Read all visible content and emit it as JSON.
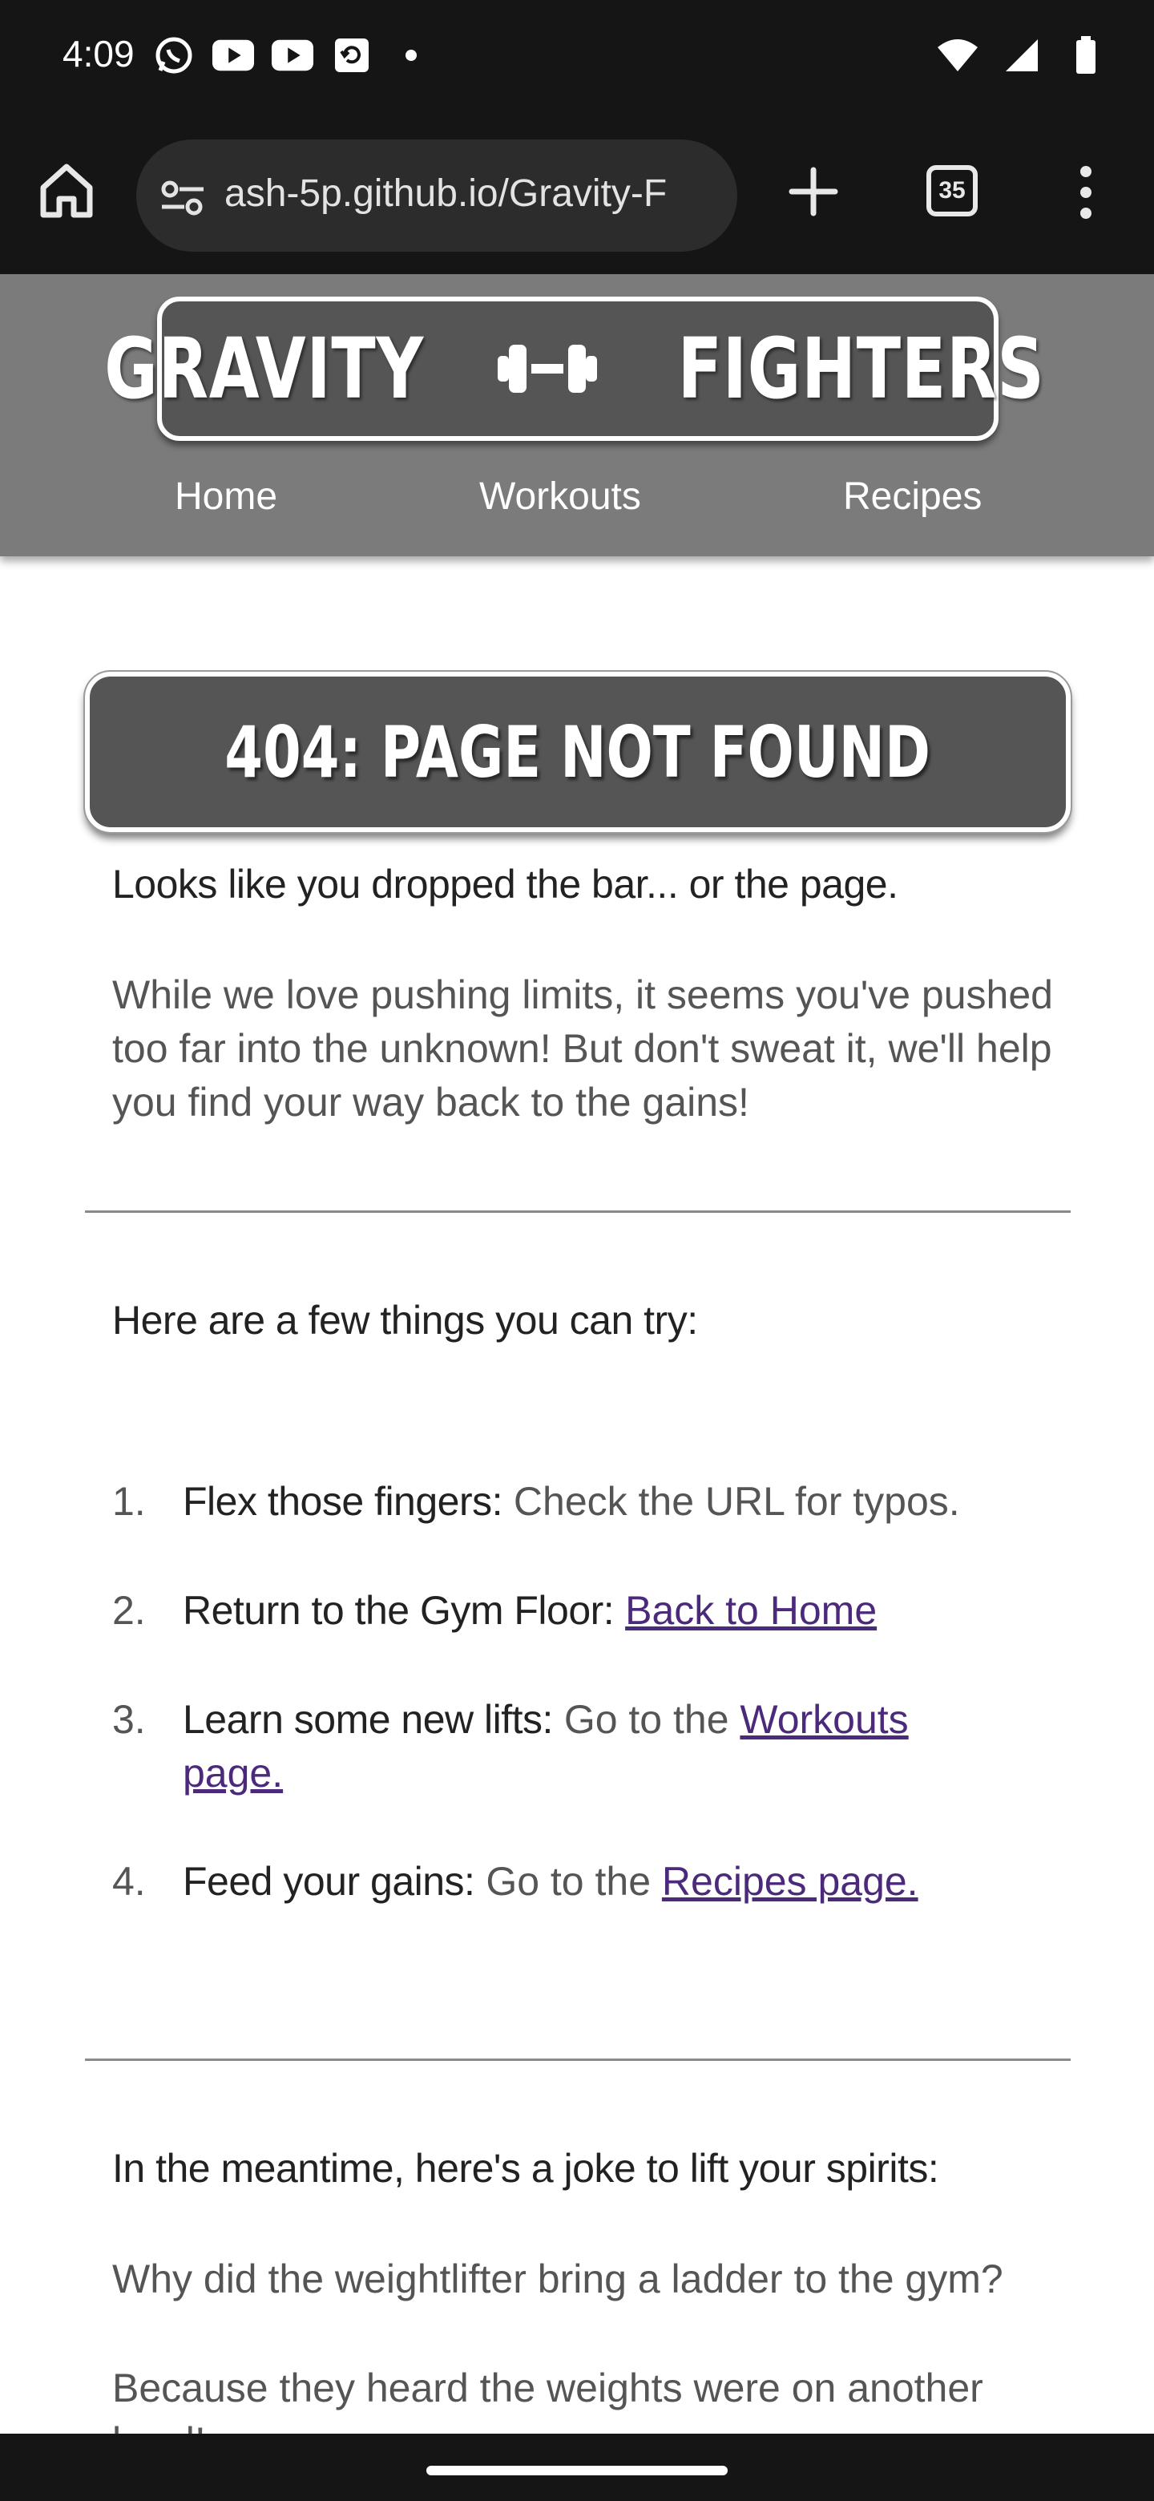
{
  "status_bar": {
    "time": "4:09",
    "left_icons": [
      "whatsapp-icon",
      "youtube-icon",
      "youtube-icon",
      "screen-share-icon",
      "dot-icon"
    ],
    "right_icons": [
      "wifi-icon",
      "signal-icon",
      "battery-icon"
    ]
  },
  "browser": {
    "url": "ash-5p.github.io/Gravity-F",
    "tab_count": "35"
  },
  "site": {
    "logo_left": "GRAVITY",
    "logo_right": "FIGHTERS",
    "nav": [
      "Home",
      "Workouts",
      "Recipes"
    ]
  },
  "main": {
    "title": "404: PAGE NOT FOUND",
    "subheading": "Looks like you dropped the bar... or the page.",
    "intro": "While we love pushing limits, it seems you've pushed too far into the unknown! But don't sweat it, we'll help you find your way back to the gains!",
    "try_heading": "Here are a few things you can try:",
    "items": [
      {
        "num": "1.",
        "bold": "Flex those fingers:",
        "text": " Check the URL for typos.",
        "link": ""
      },
      {
        "num": "2.",
        "bold": "Return to the Gym Floor:",
        "text": " ",
        "link": "Back to Home"
      },
      {
        "num": "3.",
        "bold": "Learn some new lifts:",
        "text": " Go to the ",
        "link": "Workouts page."
      },
      {
        "num": "4.",
        "bold": "Feed your gains:",
        "text": " Go to the ",
        "link": "Recipes page."
      }
    ],
    "joke_heading": "In the meantime, here's a joke to lift your spirits:",
    "joke_question": "Why did the weightlifter bring a ladder to the gym?",
    "joke_answer": "Because they heard the weights were on another level!"
  },
  "colors": {
    "header_bg": "#7b7b7b",
    "box_bg": "#555555",
    "link": "#4b2a7b",
    "chrome_bg": "#151515"
  }
}
